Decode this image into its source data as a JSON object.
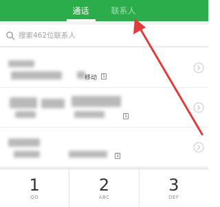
{
  "header": {
    "tabs": [
      {
        "label": "通话",
        "active": true
      },
      {
        "label": "联系人",
        "active": false
      }
    ],
    "accent_color": "#2aad4a"
  },
  "search": {
    "placeholder": "搜索462位联系人",
    "icon": "search-icon"
  },
  "contacts": [
    {
      "name": "",
      "number_label": "移动",
      "sim": "1"
    },
    {
      "name": "",
      "number_label": "",
      "sim": "1"
    },
    {
      "name": "",
      "number_label": "",
      "sim": "1"
    }
  ],
  "dialpad": {
    "keys": [
      {
        "digit": "1",
        "letters": "QO"
      },
      {
        "digit": "2",
        "letters": "ABC"
      },
      {
        "digit": "3",
        "letters": "DEF"
      }
    ]
  },
  "annotation": {
    "color": "#e03c3c"
  }
}
